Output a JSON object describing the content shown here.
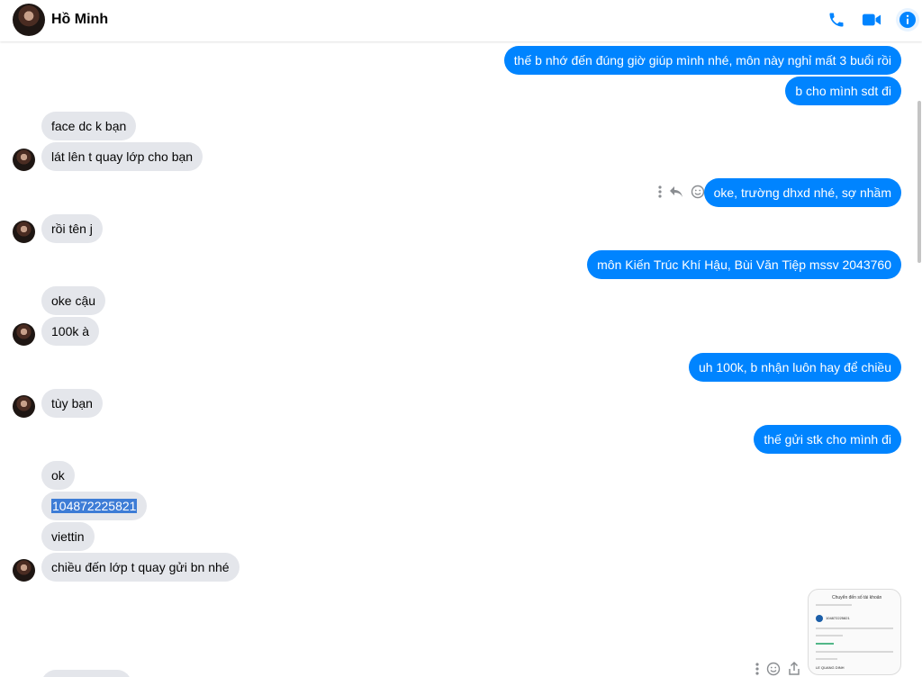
{
  "header": {
    "contact_name": "Hồ Minh",
    "icons": [
      "phone-icon",
      "video-icon",
      "info-icon"
    ],
    "accent": "#0084ff"
  },
  "messages": {
    "m1": "thế b nhớ đến đúng giờ giúp mình nhé, môn này nghỉ mất 3 buổi rồi",
    "m2": "b cho mình sdt đi",
    "m3": "face dc k bạn",
    "m4": "lát lên t quay lớp cho bạn",
    "m5": "oke, trường dhxd nhé, sợ nhầm",
    "m6": "rồi tên j",
    "m7": "môn Kiến Trúc Khí Hậu, Bùi Văn Tiệp mssv 2043760",
    "m8": "oke cậu",
    "m9": "100k à",
    "m10": "uh 100k, b nhận luôn hay để chiều",
    "m11": "tùy bạn",
    "m12": "thế gửi stk cho mình đi",
    "m13": "ok",
    "m14": "104872225821",
    "m15": "viettin",
    "m16": "chiều đến lớp t quay gửi bn nhé"
  },
  "attachment": {
    "title": "Chuyển đến số tài khoản",
    "account": "104872225821",
    "name": "LE QUANG DINH"
  },
  "colors": {
    "incoming": "#e4e6eb",
    "outgoing": "#0084ff"
  }
}
